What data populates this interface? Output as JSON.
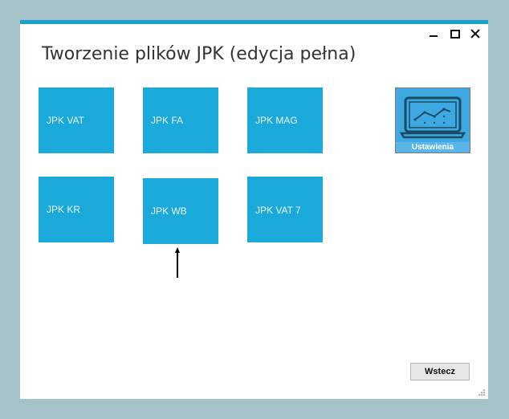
{
  "window": {
    "title": "Tworzenie plików JPK (edycja pełna)"
  },
  "tiles": [
    {
      "label": "JPK VAT"
    },
    {
      "label": "JPK FA"
    },
    {
      "label": "JPK MAG"
    },
    {
      "label": "JPK KR"
    },
    {
      "label": "JPK WB"
    },
    {
      "label": "JPK VAT 7"
    }
  ],
  "settings": {
    "label": "Ustawienia",
    "icon": "laptop-chart-icon"
  },
  "footer": {
    "back_label": "Wstecz"
  },
  "colors": {
    "accent": "#1aa0d0",
    "tile": "#1ba9d9",
    "background": "#a3c1c7"
  }
}
